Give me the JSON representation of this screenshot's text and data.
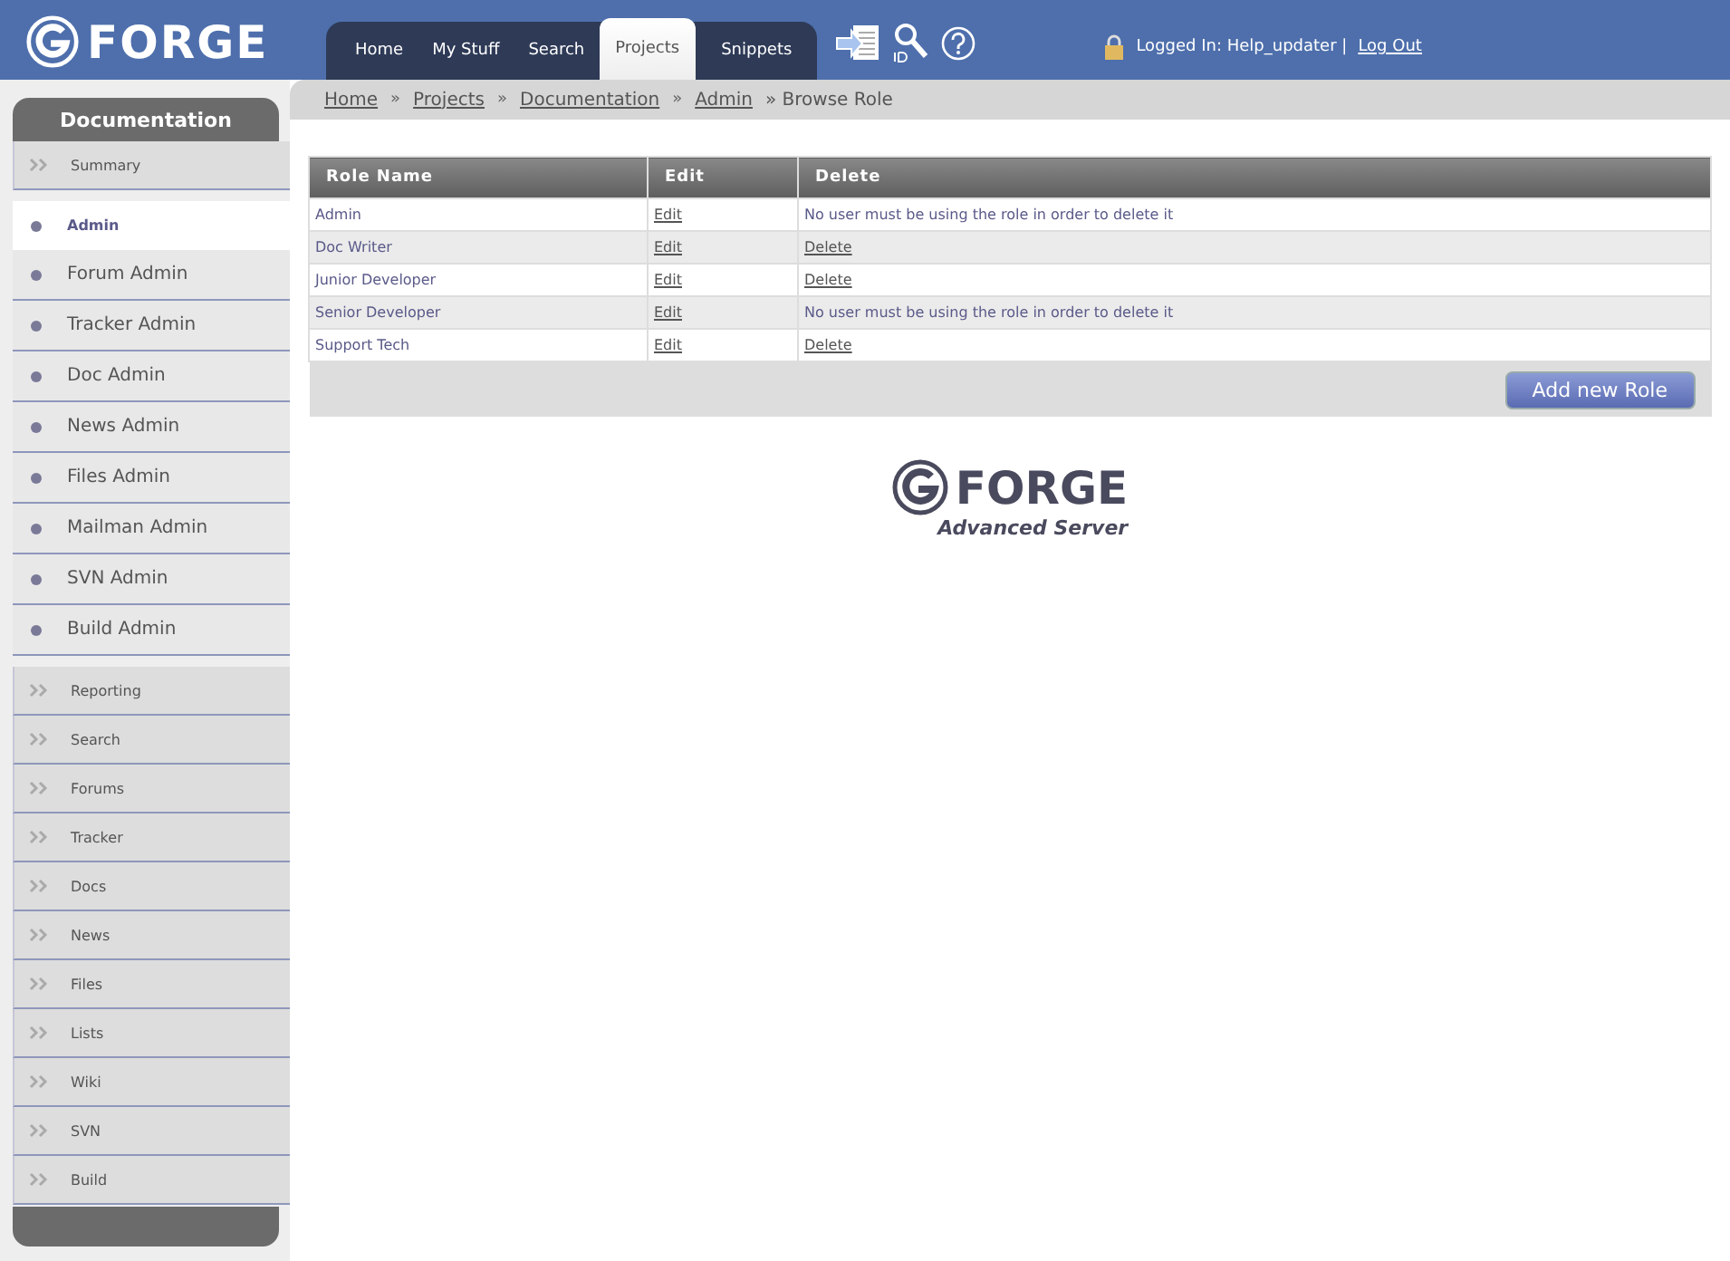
{
  "header": {
    "logo": "FORGE",
    "tabs": [
      {
        "label": "Home",
        "selected": false
      },
      {
        "label": "My Stuff",
        "selected": false
      },
      {
        "label": "Search",
        "selected": false
      },
      {
        "label": "Projects",
        "selected": true
      },
      {
        "label": "Snippets",
        "selected": false
      }
    ],
    "login_text": "Logged In: Help_updater |",
    "logout": "Log Out"
  },
  "sidebar": {
    "title": "Documentation",
    "items": [
      {
        "label": "Summary",
        "kind": "section",
        "selected": false
      },
      {
        "label": "Admin",
        "kind": "sub",
        "selected": true
      },
      {
        "label": "Forum Admin",
        "kind": "sub",
        "selected": false
      },
      {
        "label": "Tracker Admin",
        "kind": "sub",
        "selected": false
      },
      {
        "label": "Doc Admin",
        "kind": "sub",
        "selected": false
      },
      {
        "label": "News Admin",
        "kind": "sub",
        "selected": false
      },
      {
        "label": "Files Admin",
        "kind": "sub",
        "selected": false
      },
      {
        "label": "Mailman Admin",
        "kind": "sub",
        "selected": false
      },
      {
        "label": "SVN Admin",
        "kind": "sub",
        "selected": false
      },
      {
        "label": "Build Admin",
        "kind": "sub",
        "selected": false
      },
      {
        "label": "Reporting",
        "kind": "section",
        "selected": false
      },
      {
        "label": "Search",
        "kind": "section",
        "selected": false
      },
      {
        "label": "Forums",
        "kind": "section",
        "selected": false
      },
      {
        "label": "Tracker",
        "kind": "section",
        "selected": false
      },
      {
        "label": "Docs",
        "kind": "section",
        "selected": false
      },
      {
        "label": "News",
        "kind": "section",
        "selected": false
      },
      {
        "label": "Files",
        "kind": "section",
        "selected": false
      },
      {
        "label": "Lists",
        "kind": "section",
        "selected": false
      },
      {
        "label": "Wiki",
        "kind": "section",
        "selected": false
      },
      {
        "label": "SVN",
        "kind": "section",
        "selected": false
      },
      {
        "label": "Build",
        "kind": "section",
        "selected": false
      }
    ]
  },
  "breadcrumb": [
    {
      "kind": "link",
      "text": "Home"
    },
    {
      "kind": "sep",
      "text": "»"
    },
    {
      "kind": "link",
      "text": "Projects"
    },
    {
      "kind": "sep",
      "text": "»"
    },
    {
      "kind": "link",
      "text": "Documentation"
    },
    {
      "kind": "sep",
      "text": "»"
    },
    {
      "kind": "link",
      "text": "Admin"
    },
    {
      "kind": "current",
      "text": "» Browse Role"
    }
  ],
  "table": {
    "columns": [
      "Role Name",
      "Edit",
      "Delete"
    ],
    "rows": [
      {
        "role": "Admin",
        "edit": "Edit",
        "delete": {
          "kind": "note",
          "text": "No user must be using the role in order to delete it"
        }
      },
      {
        "role": "Doc Writer",
        "edit": "Edit",
        "delete": {
          "kind": "link",
          "text": "Delete"
        }
      },
      {
        "role": "Junior Developer",
        "edit": "Edit",
        "delete": {
          "kind": "link",
          "text": "Delete"
        }
      },
      {
        "role": "Senior Developer",
        "edit": "Edit",
        "delete": {
          "kind": "note",
          "text": "No user must be using the role in order to delete it"
        }
      },
      {
        "role": "Support Tech",
        "edit": "Edit",
        "delete": {
          "kind": "link",
          "text": "Delete"
        }
      }
    ],
    "add_button": "Add new Role"
  },
  "footer_logo": {
    "name": "FORGE",
    "tagline": "Advanced Server"
  }
}
